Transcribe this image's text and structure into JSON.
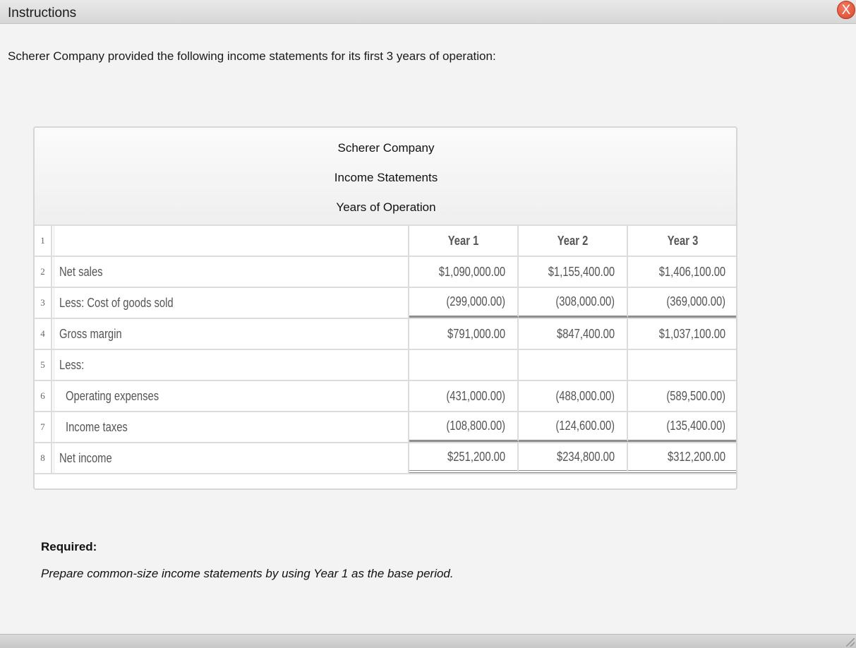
{
  "window": {
    "title": "Instructions",
    "close_label": "X"
  },
  "intro": "Scherer Company provided the following income statements for its first 3 years of operation:",
  "statement": {
    "heading_lines": [
      "Scherer Company",
      "Income Statements",
      "Years of Operation"
    ],
    "column_headers": [
      "Year 1",
      "Year 2",
      "Year 3"
    ],
    "rows": [
      {
        "num": "1",
        "label": "",
        "values": [
          "Year 1",
          "Year 2",
          "Year 3"
        ]
      },
      {
        "num": "2",
        "label": "Net sales",
        "values": [
          "$1,090,000.00",
          "$1,155,400.00",
          "$1,406,100.00"
        ]
      },
      {
        "num": "3",
        "label": "Less: Cost of goods sold",
        "values": [
          "(299,000.00)",
          "(308,000.00)",
          "(369,000.00)"
        ]
      },
      {
        "num": "4",
        "label": "Gross margin",
        "values": [
          "$791,000.00",
          "$847,400.00",
          "$1,037,100.00"
        ]
      },
      {
        "num": "5",
        "label": "Less:",
        "values": [
          "",
          "",
          ""
        ]
      },
      {
        "num": "6",
        "label": "Operating expenses",
        "values": [
          "(431,000.00)",
          "(488,000.00)",
          "(589,500.00)"
        ]
      },
      {
        "num": "7",
        "label": "Income taxes",
        "values": [
          "(108,800.00)",
          "(124,600.00)",
          "(135,400.00)"
        ]
      },
      {
        "num": "8",
        "label": "Net income",
        "values": [
          "$251,200.00",
          "$234,800.00",
          "$312,200.00"
        ]
      }
    ]
  },
  "required": {
    "title": "Required:",
    "text": "Prepare common-size income statements by using Year 1 as the base period."
  },
  "colors": {
    "close_button": "#e0553a",
    "background": "#f2f3f2"
  }
}
